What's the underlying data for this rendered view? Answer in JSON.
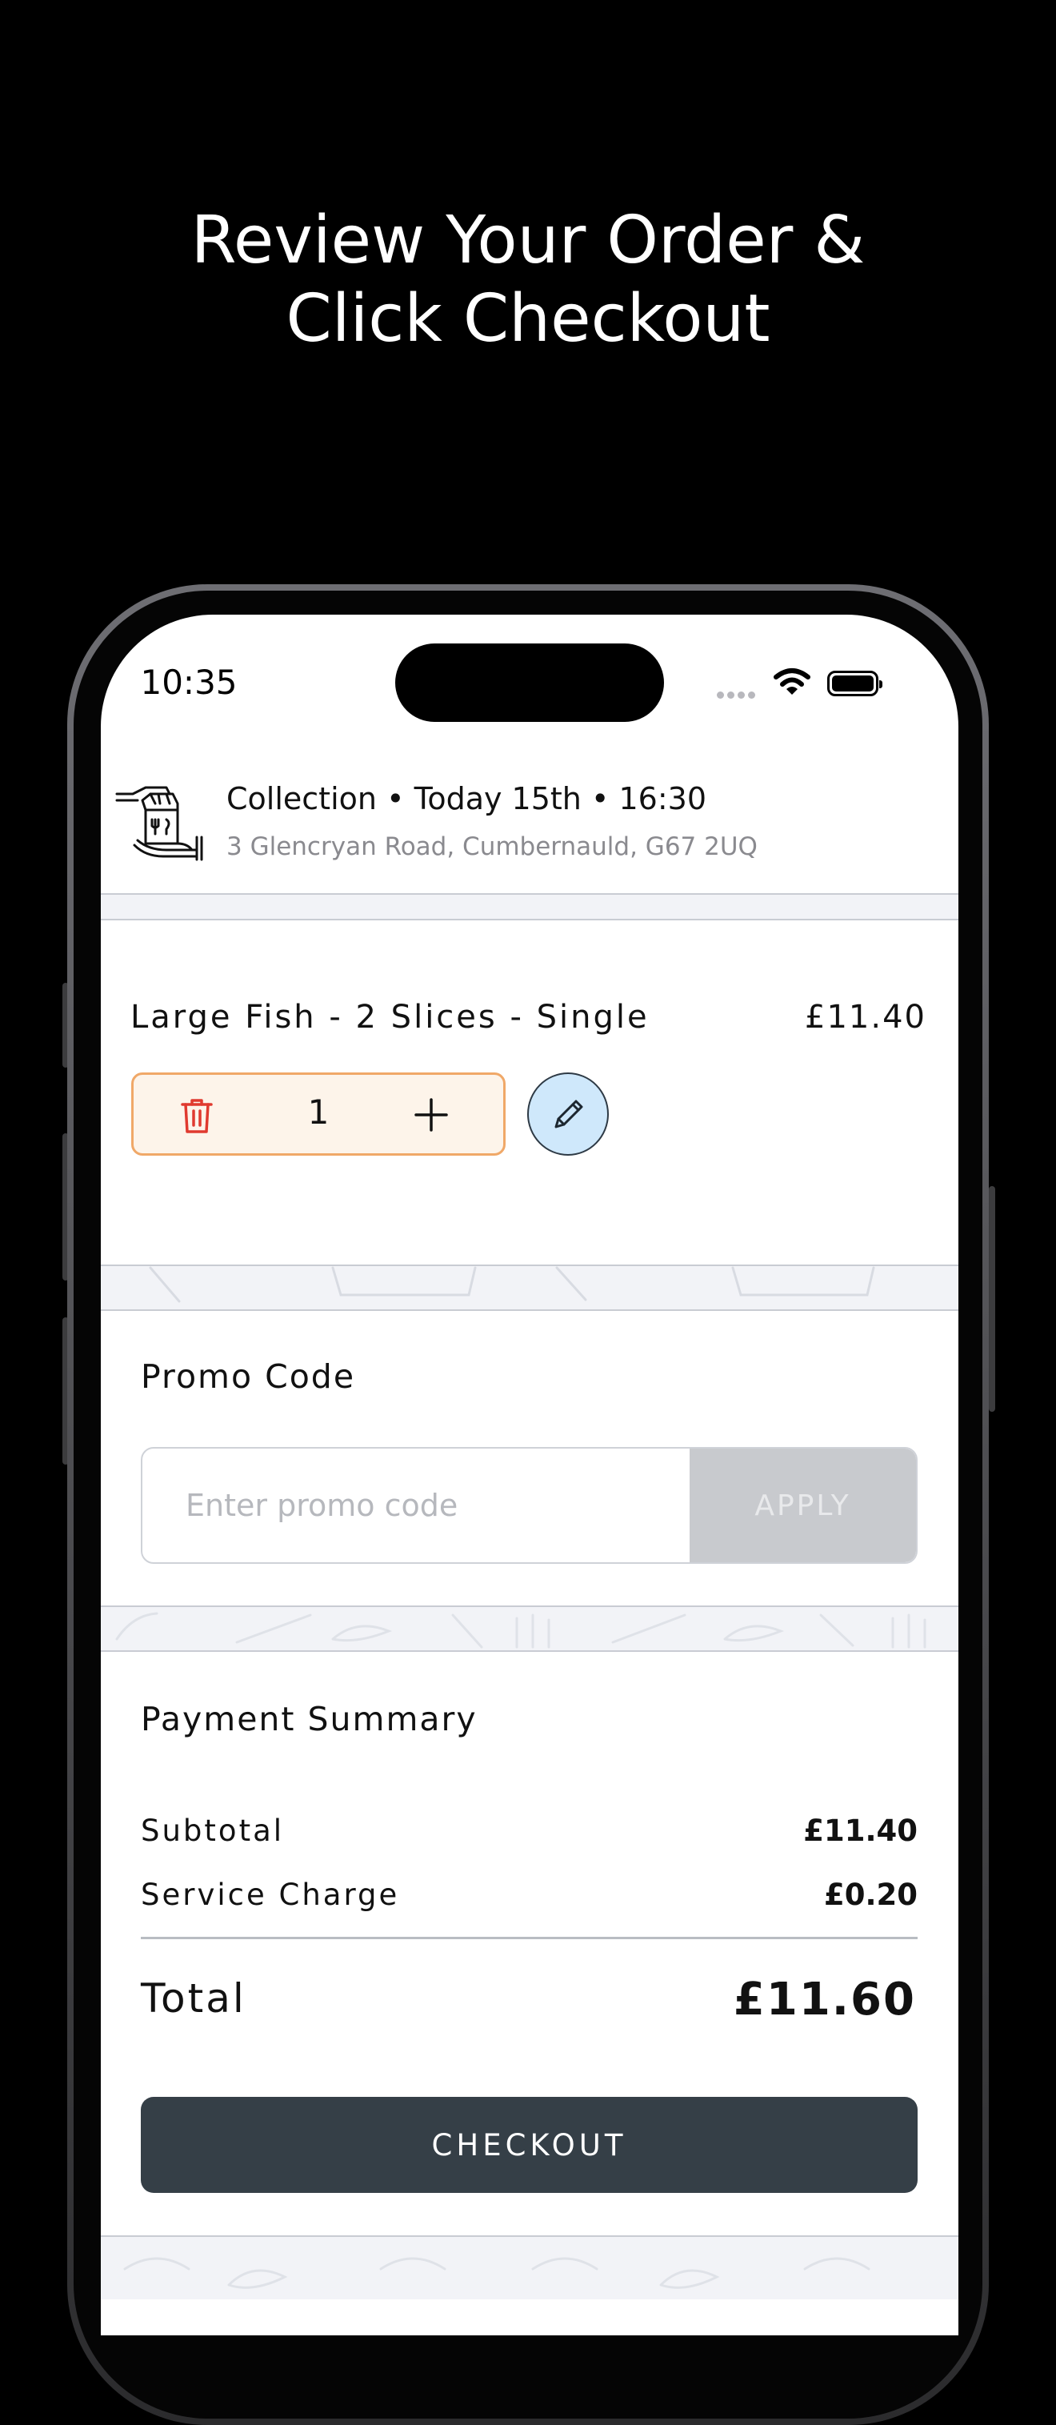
{
  "promo_banner": {
    "line1": "Review Your Order &",
    "line2": "Click Checkout"
  },
  "status_bar": {
    "time": "10:35",
    "icons": [
      "signal-icon",
      "wifi-icon",
      "battery-icon"
    ]
  },
  "header": {
    "icon": "collection-bag-hand-icon",
    "order_type": "Collection",
    "date": "Today 15th",
    "time": "16:30",
    "address": "3 Glencryan Road, Cumbernauld, G67  2UQ"
  },
  "cart": {
    "items": [
      {
        "name": "Large Fish - 2 Slices - Single",
        "price": "£11.40",
        "quantity": "1"
      }
    ]
  },
  "promo": {
    "title": "Promo Code",
    "placeholder": "Enter promo code",
    "value": "",
    "apply_label": "APPLY"
  },
  "summary": {
    "title": "Payment Summary",
    "subtotal_label": "Subtotal",
    "subtotal_value": "£11.40",
    "service_label": "Service Charge",
    "service_value": "£0.20",
    "total_label": "Total",
    "total_value": "£11.60"
  },
  "checkout_label": "CHECKOUT",
  "colors": {
    "page_background": "#000000",
    "quantity_border": "#f0a868",
    "quantity_background": "#fdf4ea",
    "trash_icon": "#e03a2f",
    "edit_button": "#cfe8fb",
    "apply_disabled": "#c8cace",
    "checkout_button": "#353f47"
  }
}
